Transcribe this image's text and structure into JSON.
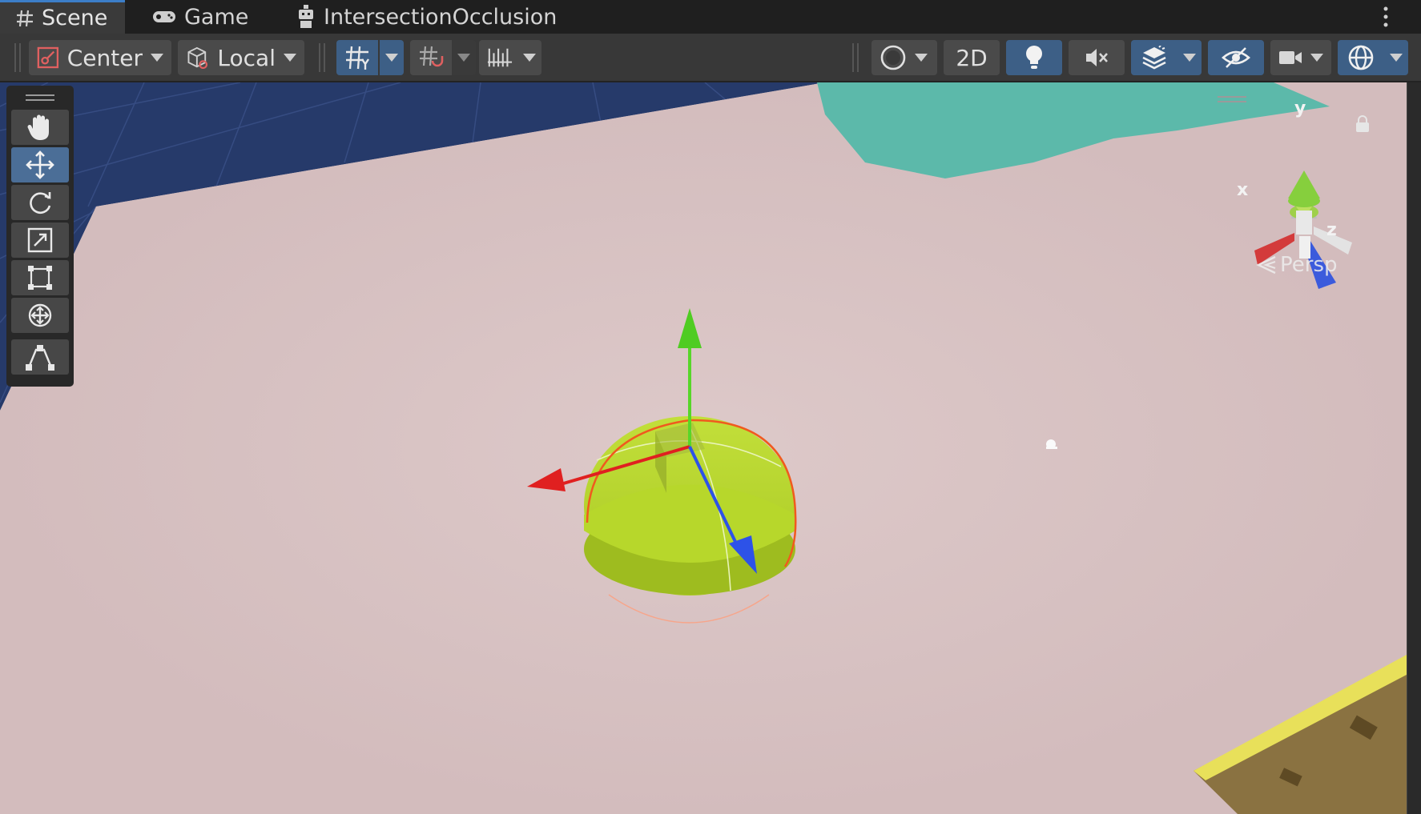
{
  "tabs": [
    {
      "label": "Scene",
      "icon": "grid-hash-icon",
      "active": true
    },
    {
      "label": "Game",
      "icon": "gamepad-icon",
      "active": false
    },
    {
      "label": "IntersectionOcclusion",
      "icon": "robot-icon",
      "active": false
    }
  ],
  "toolbar": {
    "pivot_label": "Center",
    "space_label": "Local",
    "twod_label": "2D",
    "icons": [
      "pivot-center-icon",
      "local-space-cube-icon",
      "grid-snap-icon",
      "increment-snap-icon",
      "ruler-snap-icon",
      "shading-mode-icon",
      "lighting-bulb-icon",
      "audio-mute-icon",
      "effects-stack-icon",
      "scene-visibility-icon",
      "camera-icon",
      "gizmos-icon"
    ]
  },
  "tools": [
    "hand-tool",
    "move-tool",
    "rotate-tool",
    "scale-tool",
    "rect-tool",
    "transform-tool",
    "custom-editor-tool"
  ],
  "active_tool": "move-tool",
  "orientation_gizmo": {
    "x_label": "x",
    "y_label": "y",
    "z_label": "z",
    "projection_label": "Persp"
  },
  "colors": {
    "accent": "#3c7ec8",
    "active_button": "#3d5f86",
    "ground": "#d3bcbd",
    "object": "#b7d72b",
    "x_axis": "#e02020",
    "y_axis": "#57d629",
    "z_axis": "#2d52e8",
    "water": "#5cb9aa",
    "sky_grid": "#263a6a"
  }
}
